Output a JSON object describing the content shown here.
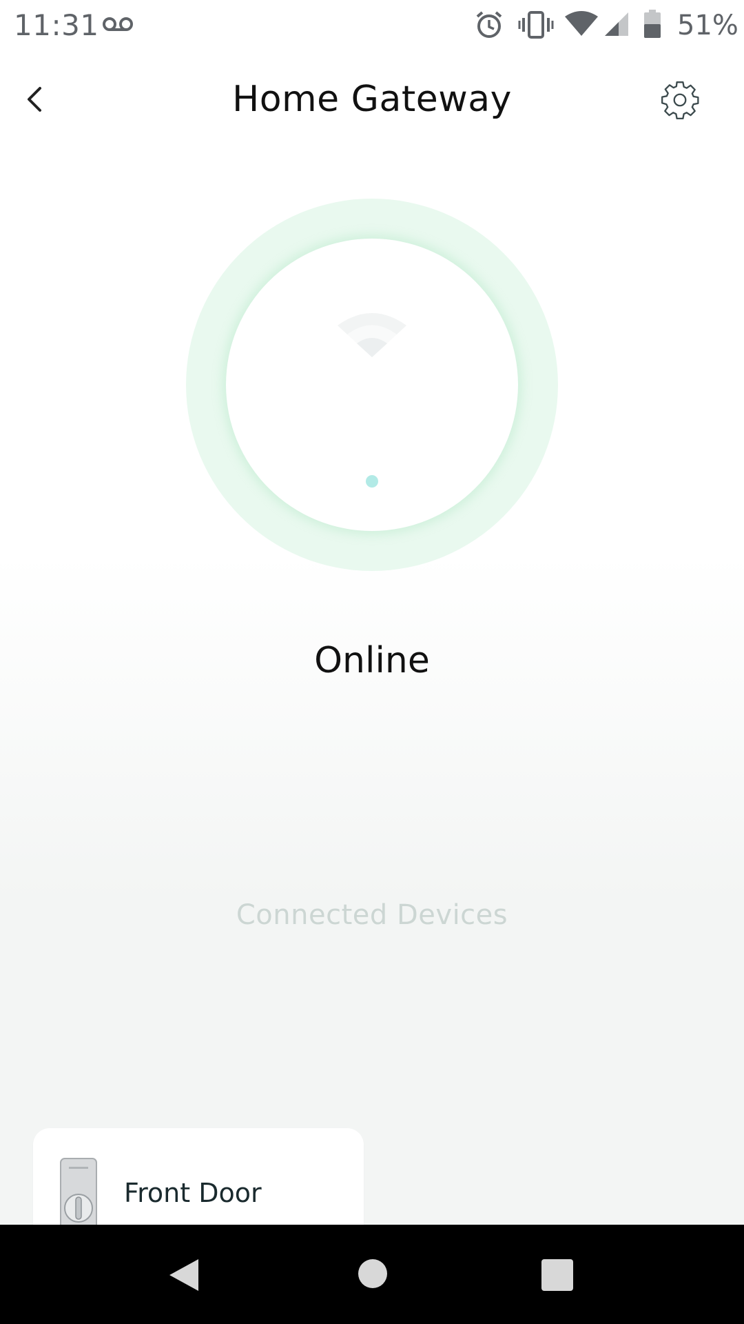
{
  "status_bar": {
    "time": "11:31",
    "battery_percent": "51%",
    "icons": [
      "voicemail-icon",
      "alarm-icon",
      "vibrate-icon",
      "wifi-icon",
      "cell-signal-icon",
      "battery-icon"
    ]
  },
  "header": {
    "title": "Home Gateway",
    "back_icon": "chevron-left-icon",
    "settings_icon": "gear-icon"
  },
  "gateway": {
    "status": "Online",
    "icon": "wifi-icon",
    "accent_color": "#e9f9ef",
    "dot_color": "#b2eae6"
  },
  "connected_devices": {
    "title": "Connected Devices",
    "devices": [
      {
        "name": "Front Door",
        "icon": "smart-lock-icon"
      }
    ]
  },
  "nav_bar": {
    "icons": [
      "nav-back-icon",
      "nav-home-icon",
      "nav-recents-icon"
    ]
  }
}
